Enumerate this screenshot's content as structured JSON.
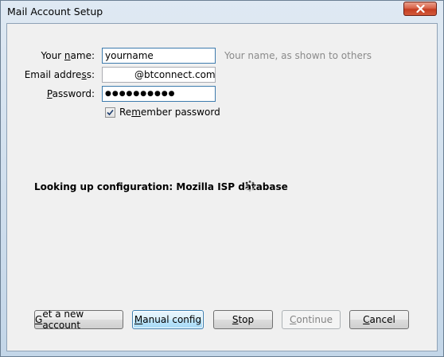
{
  "window": {
    "title": "Mail Account Setup"
  },
  "form": {
    "name_label_pre": "Your ",
    "name_label_accel": "n",
    "name_label_post": "ame:",
    "name_value": "yourname",
    "name_hint": "Your name, as shown to others",
    "email_label_pre": "Email addre",
    "email_label_accel": "s",
    "email_label_post": "s:",
    "email_value": "@btconnect.com",
    "password_label_accel": "P",
    "password_label_post": "assword:",
    "password_value": "●●●●●●●●●●",
    "remember_label_pre": "Re",
    "remember_label_accel": "m",
    "remember_label_post": "ember password",
    "remember_checked": true
  },
  "status": {
    "text": "Looking up configuration: Mozilla ISP database"
  },
  "buttons": {
    "new_account_accel": "G",
    "new_account_post": "et a new account",
    "manual_accel": "M",
    "manual_post": "anual config",
    "stop_accel": "S",
    "stop_post": "top",
    "continue_accel": "C",
    "continue_post": "ontinue",
    "cancel_accel": "C",
    "cancel_post": "ancel"
  },
  "icons": {
    "close": "close-icon",
    "checkbox": "checkmark-icon",
    "spinner": "loading-spinner-icon"
  }
}
